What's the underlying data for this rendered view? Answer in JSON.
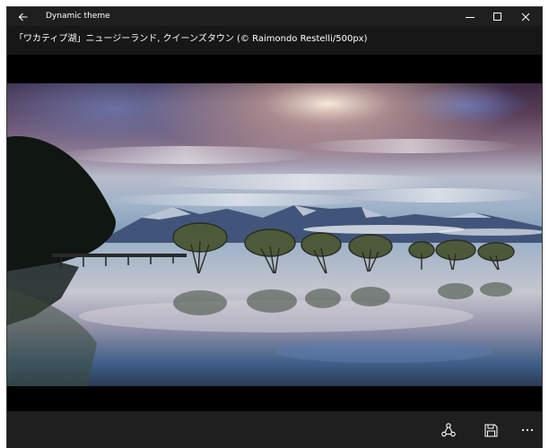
{
  "window": {
    "title": "Dynamic theme"
  },
  "photo": {
    "caption": "「ワカティプ湖」ニュージーランド, クイーンズタウン (© Raimondo Restelli/500px)"
  },
  "icons": {
    "back": "back-arrow-icon",
    "minimize": "minimize-icon",
    "maximize": "maximize-icon",
    "close": "close-icon",
    "share": "share-icon",
    "save": "save-icon",
    "more": "more-icon"
  },
  "colors": {
    "titlebar": "#1f1f1f",
    "caption_bar": "#171717",
    "stage": "#000000",
    "text": "#ffffff"
  }
}
